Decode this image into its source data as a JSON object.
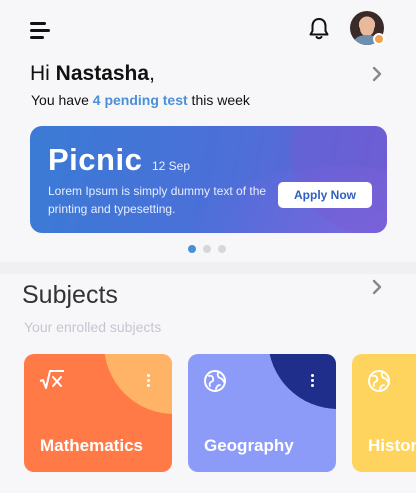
{
  "greeting": {
    "hi": "Hi ",
    "name": "Nastasha",
    "comma": ",",
    "sub_prefix": "You have ",
    "pending": "4 pending test",
    "sub_suffix": " this week"
  },
  "banner": {
    "title": "Picnic",
    "date": "12 Sep",
    "text": "Lorem Ipsum is simply dummy text of the printing and typesetting.",
    "button": "Apply Now"
  },
  "carousel": {
    "count": 3,
    "active": 0
  },
  "subjects": {
    "title": "Subjects",
    "subtitle": "Your enrolled subjects",
    "cards": [
      {
        "label": "Mathematics",
        "icon": "square-root-icon",
        "color": "#ff7a47",
        "accent": "#ffb366"
      },
      {
        "label": "Geography",
        "icon": "globe-icon",
        "color": "#8c9bf7",
        "accent": "#1f2e8a"
      },
      {
        "label": "History",
        "icon": "globe-icon",
        "color": "#ffd45e",
        "accent": "#ffe08a"
      }
    ]
  },
  "colors": {
    "accent": "#4a90d9",
    "banner_start": "#3a7bd5",
    "banner_end": "#6b5fd6"
  },
  "icons": {
    "menu": "menu-icon",
    "bell": "bell-icon",
    "chevron": "chevron-right-icon",
    "avatar_badge": "status-badge"
  }
}
